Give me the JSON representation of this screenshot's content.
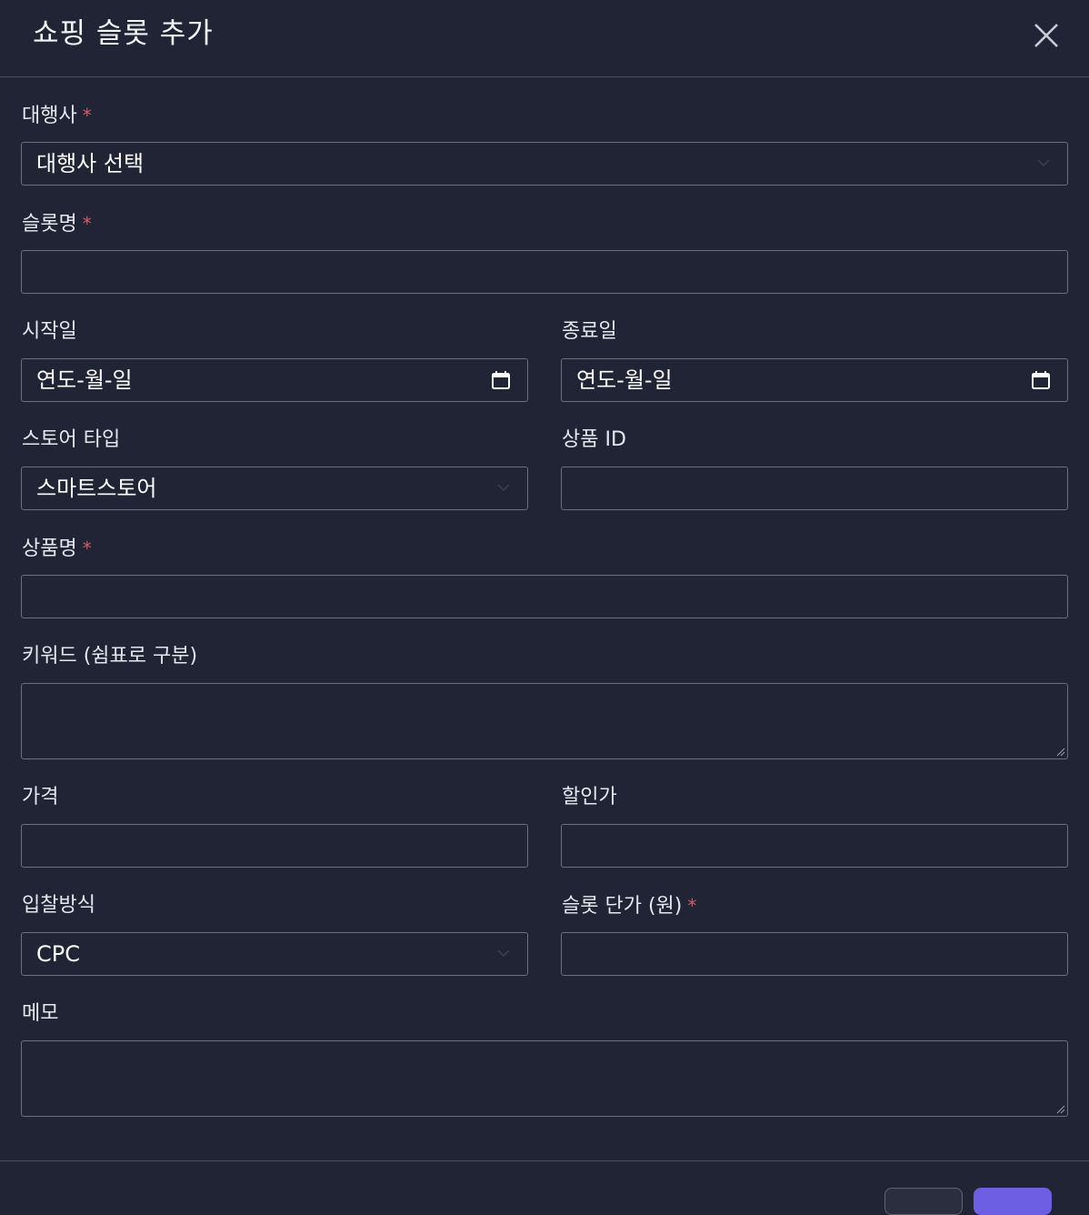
{
  "dialog": {
    "title": "쇼핑 슬롯 추가"
  },
  "form": {
    "agency": {
      "label": "대행사",
      "required_mark": "*",
      "value": "대행사 선택"
    },
    "slot_name": {
      "label": "슬롯명",
      "required_mark": "*",
      "value": ""
    },
    "start_date": {
      "label": "시작일",
      "placeholder": "연도-월-일"
    },
    "end_date": {
      "label": "종료일",
      "placeholder": "연도-월-일"
    },
    "store_type": {
      "label": "스토어 타입",
      "value": "스마트스토어"
    },
    "product_id": {
      "label": "상품 ID",
      "value": ""
    },
    "product_name": {
      "label": "상품명",
      "required_mark": "*",
      "value": ""
    },
    "keywords": {
      "label": "키워드 (쉼표로 구분)",
      "value": ""
    },
    "price": {
      "label": "가격",
      "value": ""
    },
    "discount_price": {
      "label": "할인가",
      "value": ""
    },
    "bid_method": {
      "label": "입찰방식",
      "value": "CPC"
    },
    "slot_unit_price": {
      "label": "슬롯 단가 (원)",
      "required_mark": "*",
      "value": ""
    },
    "memo": {
      "label": "메모",
      "value": ""
    }
  },
  "colors": {
    "background": "#212434",
    "border": "#6b6f80",
    "required": "#e25563",
    "primary_button": "#6d5fe3"
  },
  "icons": {
    "close": "close-icon",
    "select": "chevron-down-icon",
    "date": "calendar-icon",
    "textarea": "resize-grip-icon"
  }
}
